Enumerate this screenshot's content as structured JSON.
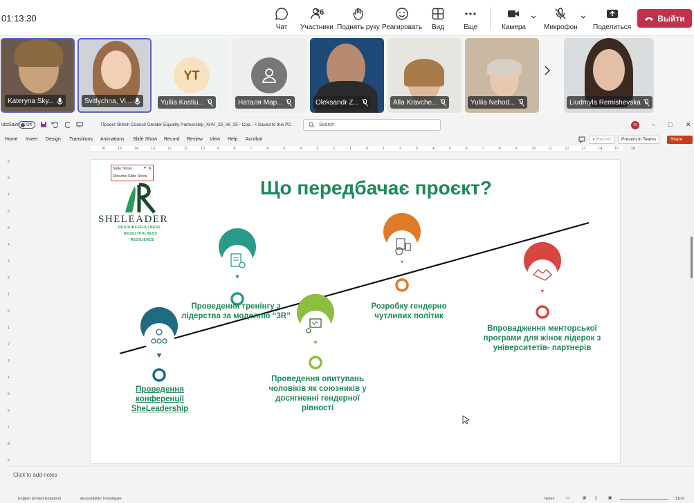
{
  "meeting": {
    "timer": "01:13:30",
    "participants_count": "26",
    "toolbar": {
      "chat": "Чат",
      "participants": "Участники",
      "raise_hand": "Поднять руку",
      "react": "Реагировать",
      "view": "Вид",
      "more": "Еще",
      "camera": "Камера",
      "mic": "Микрофон",
      "share": "Поделиться",
      "leave": "Выйти"
    },
    "participants": [
      {
        "name": "Kateryna Sky..."
      },
      {
        "name": "Svitlychna, Vi..."
      },
      {
        "name": "Yuliia Kostiu...",
        "initials": "YT"
      },
      {
        "name": "Наталя Мар..."
      },
      {
        "name": "Oleksandr Z..."
      },
      {
        "name": "Alla Kravche..."
      },
      {
        "name": "Yuliia Nehod..."
      },
      {
        "name": "Liudmyla Remishevska"
      }
    ],
    "colors": {
      "leave": "#c4314b",
      "active_border": "#5b5fc7"
    }
  },
  "ppt": {
    "autosave_label": "utoSave",
    "autosave_state": "Off",
    "doc_title": "Проект British Council Gender Equality Partnership_XHV_25_06_25 - Cop...   •  Saved to this PC",
    "search_placeholder": "Search",
    "user_initials": "IG",
    "tabs": [
      "Home",
      "Insert",
      "Design",
      "Transitions",
      "Animations",
      "Slide Show",
      "Record",
      "Review",
      "View",
      "Help",
      "Acrobat"
    ],
    "record_btn": "Record",
    "present_btn": "Present in Teams",
    "share_btn": "Share",
    "notes_placeholder": "Click to add notes",
    "status": {
      "language": "English (United Kingdom)",
      "accessibility": "Accessibility: Investigate",
      "notes": "Notes",
      "zoom": "111%"
    },
    "ruler_h": [
      "16",
      "15",
      "14",
      "13",
      "12",
      "11",
      "10",
      "9",
      "8",
      "7",
      "6",
      "5",
      "4",
      "3",
      "2",
      "1",
      "0",
      "1",
      "2",
      "3",
      "4",
      "5",
      "6",
      "7",
      "8",
      "9",
      "10",
      "11",
      "12",
      "13",
      "14",
      "15",
      "16"
    ],
    "ruler_v": [
      "9",
      "8",
      "7",
      "6",
      "5",
      "4",
      "3",
      "2",
      "1",
      "0",
      "1",
      "2",
      "3",
      "4",
      "5",
      "6",
      "7",
      "8",
      "9"
    ]
  },
  "slide": {
    "title": "Що передбачає проєкт?",
    "popup": {
      "row1": "Slide Show",
      "row2": "Resume Slide Show"
    },
    "logo": {
      "name": "SHELEADER",
      "tag1": "RESOURCEFULLNESS",
      "tag2": "RESULTFULNESS",
      "tag3": "RESILIENCE"
    },
    "items": [
      {
        "text": "Проведення конференції SheLeadership",
        "color": "#1f6b80"
      },
      {
        "text": "Проведення тренінгу з лідерства за моделлю “3R”",
        "color": "#2a9a8a"
      },
      {
        "text": "Проведення опитувань чоловіків як союзників у досягненні гендерної рівності",
        "color": "#8cbf3f"
      },
      {
        "text": "Розробку гендерно чутливих політик",
        "color": "#e07b2a"
      },
      {
        "text": "Впровадження менторської програми для жінок лідерок з університетів- партнерів",
        "color": "#d9453f"
      }
    ]
  }
}
